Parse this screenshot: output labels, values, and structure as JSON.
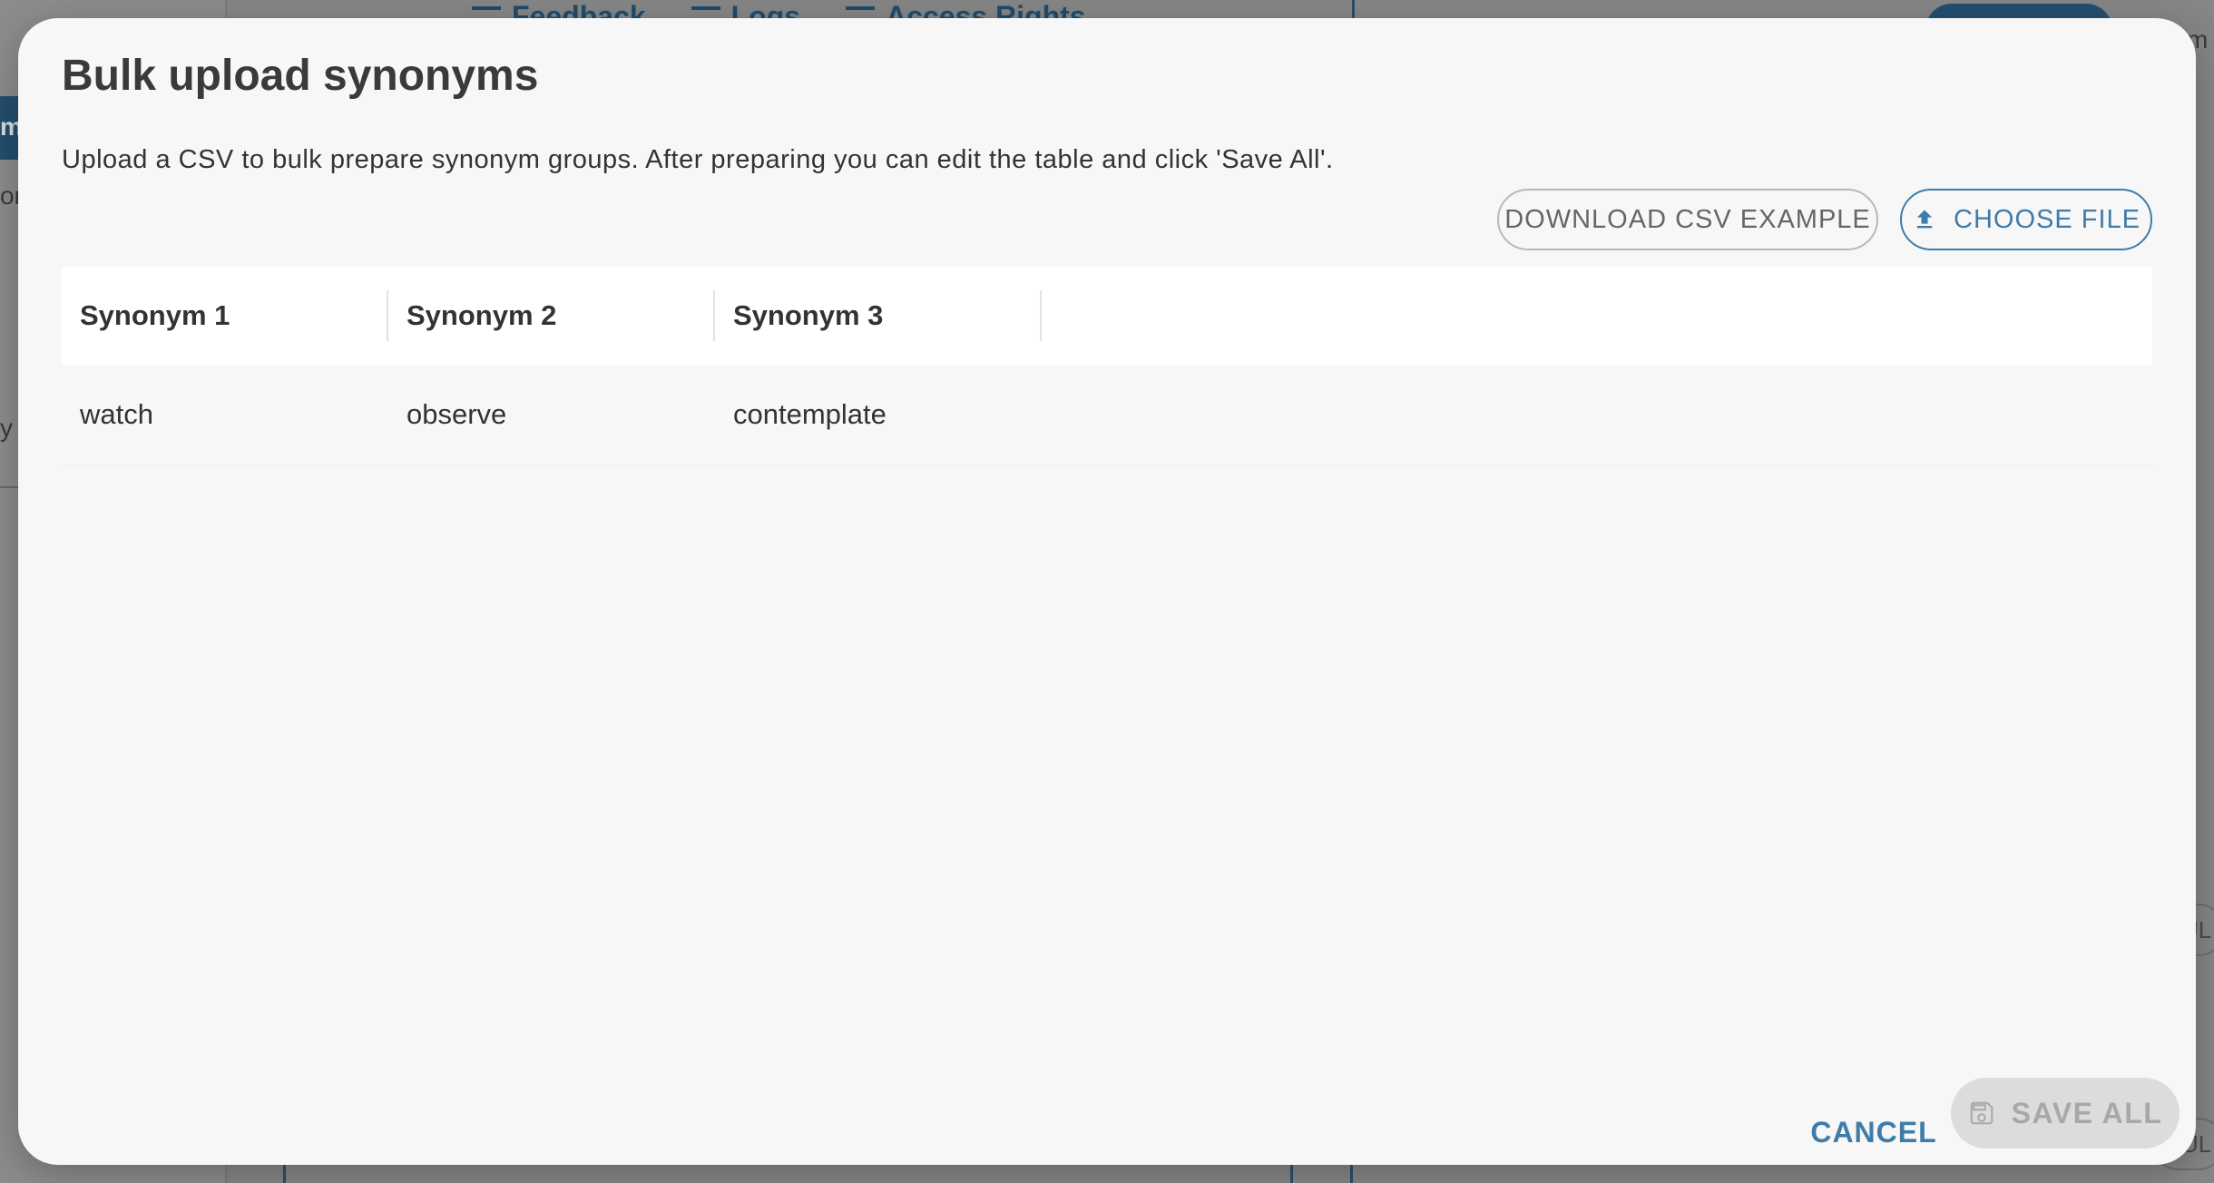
{
  "background": {
    "left_tab_text": "m",
    "left_fragments": [
      "on",
      "y"
    ],
    "nav": [
      "Feedback",
      "Logs",
      "Access Rights"
    ],
    "right_fragments": [
      "m"
    ],
    "right_pill_text": "UL"
  },
  "modal": {
    "title": "Bulk upload synonyms",
    "description": "Upload a CSV to bulk prepare synonym groups. After preparing you can edit the table and click 'Save All'.",
    "download_label": "DOWNLOAD CSV EXAMPLE",
    "choose_label": "CHOOSE FILE",
    "choose_icon": "upload-icon",
    "table": {
      "columns": [
        "Synonym 1",
        "Synonym 2",
        "Synonym 3"
      ],
      "rows": [
        [
          "watch",
          "observe",
          "contemplate"
        ]
      ]
    },
    "cancel_label": "CANCEL",
    "save_all_label": "SAVE ALL",
    "save_icon": "save-icon"
  },
  "colors": {
    "accent": "#3f7ca9",
    "disabled_bg": "#dcdcdc",
    "disabled_text": "#a8a8a8"
  }
}
